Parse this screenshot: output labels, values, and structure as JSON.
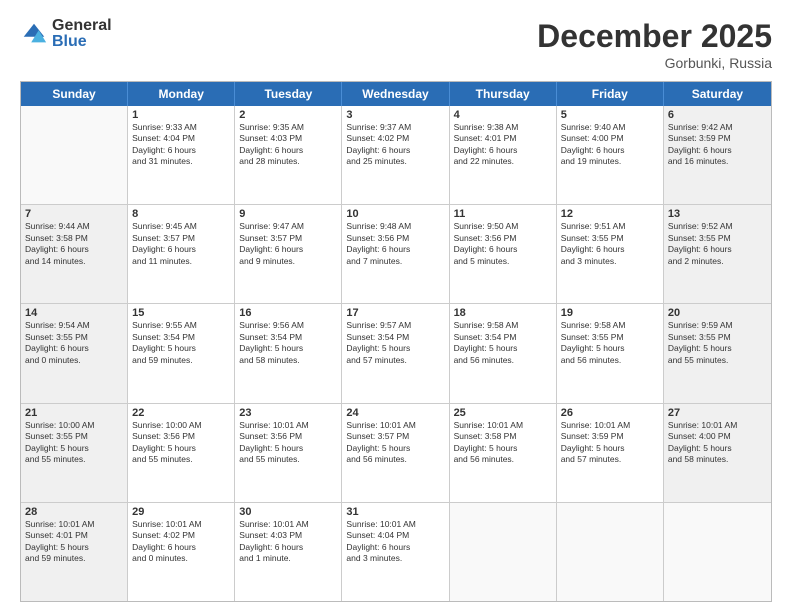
{
  "logo": {
    "general": "General",
    "blue": "Blue"
  },
  "title": "December 2025",
  "location": "Gorbunki, Russia",
  "days_of_week": [
    "Sunday",
    "Monday",
    "Tuesday",
    "Wednesday",
    "Thursday",
    "Friday",
    "Saturday"
  ],
  "weeks": [
    [
      {
        "day": "",
        "empty": true
      },
      {
        "day": "1",
        "lines": [
          "Sunrise: 9:33 AM",
          "Sunset: 4:04 PM",
          "Daylight: 6 hours",
          "and 31 minutes."
        ]
      },
      {
        "day": "2",
        "lines": [
          "Sunrise: 9:35 AM",
          "Sunset: 4:03 PM",
          "Daylight: 6 hours",
          "and 28 minutes."
        ]
      },
      {
        "day": "3",
        "lines": [
          "Sunrise: 9:37 AM",
          "Sunset: 4:02 PM",
          "Daylight: 6 hours",
          "and 25 minutes."
        ]
      },
      {
        "day": "4",
        "lines": [
          "Sunrise: 9:38 AM",
          "Sunset: 4:01 PM",
          "Daylight: 6 hours",
          "and 22 minutes."
        ]
      },
      {
        "day": "5",
        "lines": [
          "Sunrise: 9:40 AM",
          "Sunset: 4:00 PM",
          "Daylight: 6 hours",
          "and 19 minutes."
        ]
      },
      {
        "day": "6",
        "lines": [
          "Sunrise: 9:42 AM",
          "Sunset: 3:59 PM",
          "Daylight: 6 hours",
          "and 16 minutes."
        ]
      }
    ],
    [
      {
        "day": "7",
        "lines": [
          "Sunrise: 9:44 AM",
          "Sunset: 3:58 PM",
          "Daylight: 6 hours",
          "and 14 minutes."
        ]
      },
      {
        "day": "8",
        "lines": [
          "Sunrise: 9:45 AM",
          "Sunset: 3:57 PM",
          "Daylight: 6 hours",
          "and 11 minutes."
        ]
      },
      {
        "day": "9",
        "lines": [
          "Sunrise: 9:47 AM",
          "Sunset: 3:57 PM",
          "Daylight: 6 hours",
          "and 9 minutes."
        ]
      },
      {
        "day": "10",
        "lines": [
          "Sunrise: 9:48 AM",
          "Sunset: 3:56 PM",
          "Daylight: 6 hours",
          "and 7 minutes."
        ]
      },
      {
        "day": "11",
        "lines": [
          "Sunrise: 9:50 AM",
          "Sunset: 3:56 PM",
          "Daylight: 6 hours",
          "and 5 minutes."
        ]
      },
      {
        "day": "12",
        "lines": [
          "Sunrise: 9:51 AM",
          "Sunset: 3:55 PM",
          "Daylight: 6 hours",
          "and 3 minutes."
        ]
      },
      {
        "day": "13",
        "lines": [
          "Sunrise: 9:52 AM",
          "Sunset: 3:55 PM",
          "Daylight: 6 hours",
          "and 2 minutes."
        ]
      }
    ],
    [
      {
        "day": "14",
        "lines": [
          "Sunrise: 9:54 AM",
          "Sunset: 3:55 PM",
          "Daylight: 6 hours",
          "and 0 minutes."
        ]
      },
      {
        "day": "15",
        "lines": [
          "Sunrise: 9:55 AM",
          "Sunset: 3:54 PM",
          "Daylight: 5 hours",
          "and 59 minutes."
        ]
      },
      {
        "day": "16",
        "lines": [
          "Sunrise: 9:56 AM",
          "Sunset: 3:54 PM",
          "Daylight: 5 hours",
          "and 58 minutes."
        ]
      },
      {
        "day": "17",
        "lines": [
          "Sunrise: 9:57 AM",
          "Sunset: 3:54 PM",
          "Daylight: 5 hours",
          "and 57 minutes."
        ]
      },
      {
        "day": "18",
        "lines": [
          "Sunrise: 9:58 AM",
          "Sunset: 3:54 PM",
          "Daylight: 5 hours",
          "and 56 minutes."
        ]
      },
      {
        "day": "19",
        "lines": [
          "Sunrise: 9:58 AM",
          "Sunset: 3:55 PM",
          "Daylight: 5 hours",
          "and 56 minutes."
        ]
      },
      {
        "day": "20",
        "lines": [
          "Sunrise: 9:59 AM",
          "Sunset: 3:55 PM",
          "Daylight: 5 hours",
          "and 55 minutes."
        ]
      }
    ],
    [
      {
        "day": "21",
        "lines": [
          "Sunrise: 10:00 AM",
          "Sunset: 3:55 PM",
          "Daylight: 5 hours",
          "and 55 minutes."
        ]
      },
      {
        "day": "22",
        "lines": [
          "Sunrise: 10:00 AM",
          "Sunset: 3:56 PM",
          "Daylight: 5 hours",
          "and 55 minutes."
        ]
      },
      {
        "day": "23",
        "lines": [
          "Sunrise: 10:01 AM",
          "Sunset: 3:56 PM",
          "Daylight: 5 hours",
          "and 55 minutes."
        ]
      },
      {
        "day": "24",
        "lines": [
          "Sunrise: 10:01 AM",
          "Sunset: 3:57 PM",
          "Daylight: 5 hours",
          "and 56 minutes."
        ]
      },
      {
        "day": "25",
        "lines": [
          "Sunrise: 10:01 AM",
          "Sunset: 3:58 PM",
          "Daylight: 5 hours",
          "and 56 minutes."
        ]
      },
      {
        "day": "26",
        "lines": [
          "Sunrise: 10:01 AM",
          "Sunset: 3:59 PM",
          "Daylight: 5 hours",
          "and 57 minutes."
        ]
      },
      {
        "day": "27",
        "lines": [
          "Sunrise: 10:01 AM",
          "Sunset: 4:00 PM",
          "Daylight: 5 hours",
          "and 58 minutes."
        ]
      }
    ],
    [
      {
        "day": "28",
        "lines": [
          "Sunrise: 10:01 AM",
          "Sunset: 4:01 PM",
          "Daylight: 5 hours",
          "and 59 minutes."
        ]
      },
      {
        "day": "29",
        "lines": [
          "Sunrise: 10:01 AM",
          "Sunset: 4:02 PM",
          "Daylight: 6 hours",
          "and 0 minutes."
        ]
      },
      {
        "day": "30",
        "lines": [
          "Sunrise: 10:01 AM",
          "Sunset: 4:03 PM",
          "Daylight: 6 hours",
          "and 1 minute."
        ]
      },
      {
        "day": "31",
        "lines": [
          "Sunrise: 10:01 AM",
          "Sunset: 4:04 PM",
          "Daylight: 6 hours",
          "and 3 minutes."
        ]
      },
      {
        "day": "",
        "empty": true
      },
      {
        "day": "",
        "empty": true
      },
      {
        "day": "",
        "empty": true
      }
    ]
  ]
}
